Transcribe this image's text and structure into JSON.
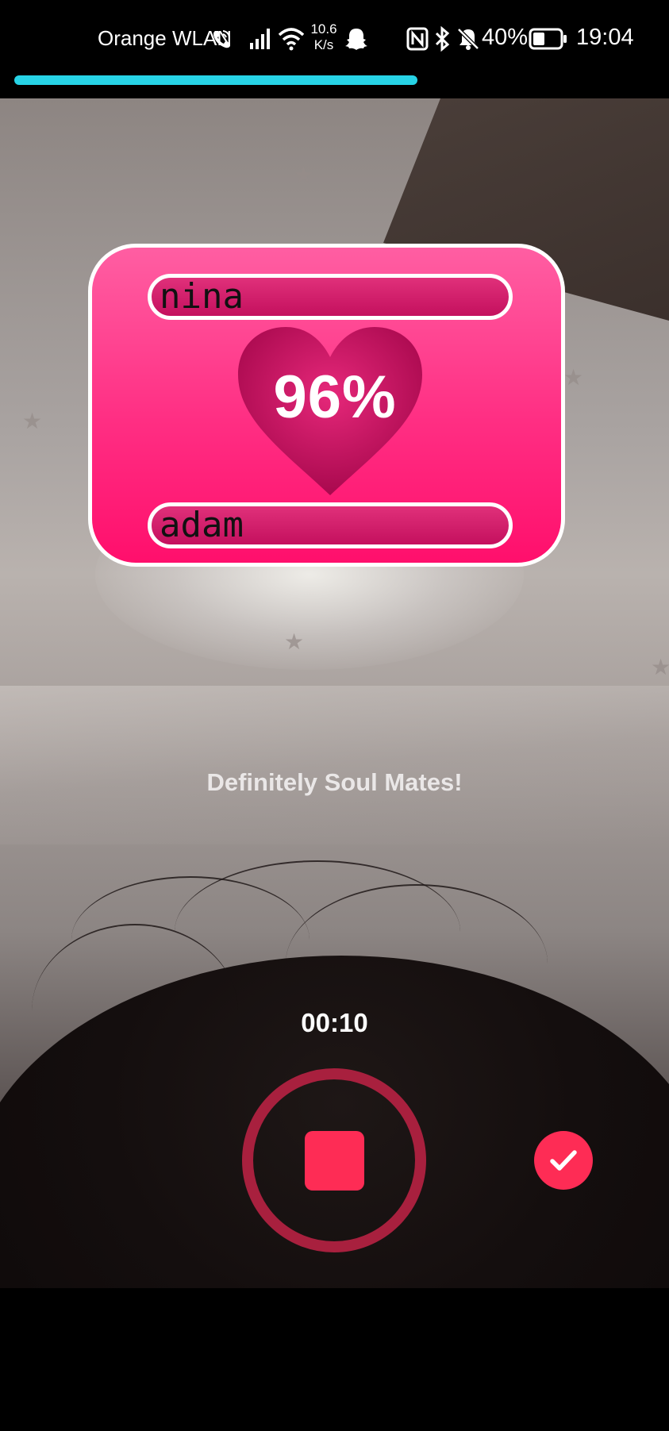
{
  "status_bar": {
    "carrier": "Orange WLAN",
    "speed_value": "10.6",
    "speed_unit": "K/s",
    "battery": "40%",
    "time": "19:04"
  },
  "recording": {
    "progress": 0.63,
    "timer": "00:10"
  },
  "love_card": {
    "name_top": "nina",
    "name_bottom": "adam",
    "percent": "96%"
  },
  "result_text": "Definitely Soul Mates!",
  "colors": {
    "progress": "#27d3e6",
    "accent": "#fe2c55",
    "card_pink": "#ff2e83"
  },
  "icons": [
    "wifi-call-icon",
    "signal-icon",
    "wifi-icon",
    "snapchat-icon",
    "nfc-icon",
    "bluetooth-icon",
    "bell-off-icon",
    "battery-icon",
    "heart-icon",
    "stop-icon",
    "check-icon"
  ]
}
